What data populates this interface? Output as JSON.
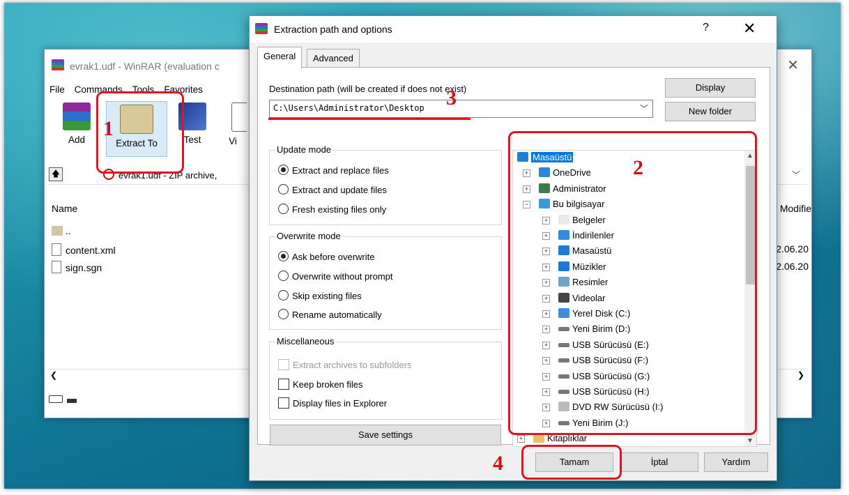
{
  "winrar": {
    "title": "evrak1.udf - WinRAR (evaluation c",
    "menu": [
      "File",
      "Commands",
      "Tools",
      "Favorites"
    ],
    "tools": [
      {
        "label": "Add",
        "icon": "add-archive-icon"
      },
      {
        "label": "Extract To",
        "icon": "extract-to-icon"
      },
      {
        "label": "Test",
        "icon": "test-icon"
      },
      {
        "label": "Vi",
        "icon": "view-icon"
      }
    ],
    "path": "evrak1.udf - ZIP archive,",
    "col_name": "Name",
    "col_modified": "Modifie",
    "rows": [
      {
        "name": "..",
        "date": ""
      },
      {
        "name": "content.xml",
        "date": "2.06.20"
      },
      {
        "name": "sign.sgn",
        "date": "2.06.20"
      }
    ]
  },
  "dialog": {
    "title": "Extraction path and options",
    "help": "?",
    "close": "✕",
    "tabs": [
      "General",
      "Advanced"
    ],
    "dest_label": "Destination path (will be created if does not exist)",
    "dest_value": "C:\\Users\\Administrator\\Desktop",
    "display_btn": "Display",
    "newfolder_btn": "New folder",
    "update_mode": {
      "title": "Update mode",
      "options": [
        "Extract and replace files",
        "Extract and update files",
        "Fresh existing files only"
      ],
      "selected": 0
    },
    "overwrite_mode": {
      "title": "Overwrite mode",
      "options": [
        "Ask before overwrite",
        "Overwrite without prompt",
        "Skip existing files",
        "Rename automatically"
      ],
      "selected": 0
    },
    "misc": {
      "title": "Miscellaneous",
      "options": [
        "Extract archives to subfolders",
        "Keep broken files",
        "Display files in Explorer"
      ]
    },
    "save_settings": "Save settings",
    "tree": [
      {
        "label": "Masaüstü",
        "level": 0,
        "icon": "desktop-icon",
        "selected": true
      },
      {
        "label": "OneDrive",
        "level": 1,
        "icon": "onedrive-icon"
      },
      {
        "label": "Administrator",
        "level": 1,
        "icon": "user-icon"
      },
      {
        "label": "Bu bilgisayar",
        "level": 1,
        "icon": "computer-icon",
        "expanded": true
      },
      {
        "label": "Belgeler",
        "level": 2,
        "icon": "documents-icon"
      },
      {
        "label": "İndirilenler",
        "level": 2,
        "icon": "downloads-icon"
      },
      {
        "label": "Masaüstü",
        "level": 2,
        "icon": "desktop-icon"
      },
      {
        "label": "Müzikler",
        "level": 2,
        "icon": "music-icon"
      },
      {
        "label": "Resimler",
        "level": 2,
        "icon": "pictures-icon"
      },
      {
        "label": "Videolar",
        "level": 2,
        "icon": "videos-icon"
      },
      {
        "label": "Yerel Disk (C:)",
        "level": 2,
        "icon": "system-drive-icon"
      },
      {
        "label": "Yeni Birim (D:)",
        "level": 2,
        "icon": "drive-icon"
      },
      {
        "label": "USB Sürücüsü (E:)",
        "level": 2,
        "icon": "usb-drive-icon"
      },
      {
        "label": "USB Sürücüsü (F:)",
        "level": 2,
        "icon": "usb-drive-icon"
      },
      {
        "label": "USB Sürücüsü (G:)",
        "level": 2,
        "icon": "usb-drive-icon"
      },
      {
        "label": "USB Sürücüsü (H:)",
        "level": 2,
        "icon": "usb-drive-icon"
      },
      {
        "label": "DVD RW Sürücüsü (I:)",
        "level": 2,
        "icon": "dvd-drive-icon"
      },
      {
        "label": "Yeni Birim (J:)",
        "level": 2,
        "icon": "drive-icon"
      },
      {
        "label": "Kitaplıklar",
        "level": 0,
        "icon": "libraries-icon"
      }
    ],
    "ok": "Tamam",
    "cancel": "İptal",
    "helpbtn": "Yardım"
  },
  "annotations": [
    "1",
    "2",
    "3",
    "4"
  ],
  "colors": {
    "accent": "#0078d7",
    "annotation": "#e0141e"
  }
}
